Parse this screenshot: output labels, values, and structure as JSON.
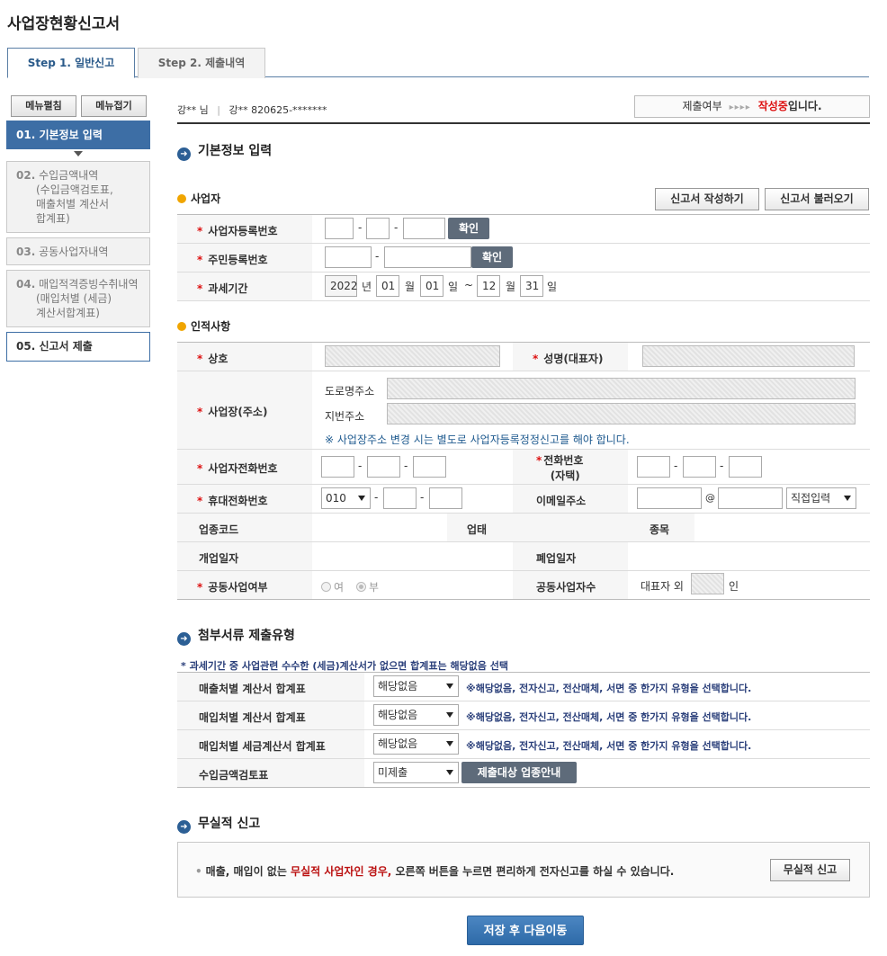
{
  "page": {
    "title": "사업장현황신고서"
  },
  "tabs": [
    {
      "label": "Step 1. 일반신고"
    },
    {
      "label": "Step 2. 제출내역"
    }
  ],
  "sidebar": {
    "menu_expand": "메뉴펼침",
    "menu_collapse": "메뉴접기",
    "items": [
      {
        "num": "01.",
        "label": "기본정보 입력"
      },
      {
        "num": "02.",
        "label": "수입금액내역",
        "sub1": "(수입금액검토표,",
        "sub2": "매출처별 계산서",
        "sub3": "합계표)"
      },
      {
        "num": "03.",
        "label": "공동사업자내역"
      },
      {
        "num": "04.",
        "label": "매입적격증빙수취내역",
        "sub1": "(매입처별 (세금)",
        "sub2": "계산서합계표)"
      },
      {
        "num": "05.",
        "label": "신고서 제출"
      }
    ]
  },
  "user": {
    "name": "강** 님",
    "sep": "|",
    "info": "강** 820625-*******"
  },
  "status": {
    "label": "제출여부",
    "arrows": "▸▸▸▸",
    "value": "작성중",
    "suffix": "입니다."
  },
  "basic": {
    "title": "기본정보 입력",
    "business_header": "사업자",
    "write_btn": "신고서 작성하기",
    "load_btn": "신고서 불러오기",
    "rows": {
      "bizno_label": "사업자등록번호",
      "resno_label": "주민등록번호",
      "period_label": "과세기간",
      "confirm": "확인",
      "dash": "-"
    },
    "period": {
      "year": "2022",
      "year_unit": "년",
      "m1": "01",
      "m_unit": "월",
      "d1": "01",
      "d_unit": "일",
      "tilde": "~",
      "m2": "12",
      "d2": "31"
    }
  },
  "personal": {
    "header": "인적사항",
    "trade_name": "상호",
    "rep_name": "성명(대표자)",
    "address": "사업장(주소)",
    "road": "도로명주소",
    "lot": "지번주소",
    "addr_note": "※ 사업장주소 변경 시는 별도로 사업자등록정정신고를 해야 합니다.",
    "biz_phone": "사업자전화번호",
    "home_phone_1": "전화번호",
    "home_phone_2": "(자택)",
    "mobile": "휴대전화번호",
    "mobile_prefix": "010",
    "email": "이메일주소",
    "at": "@",
    "email_select": "직접입력",
    "industry_code": "업종코드",
    "business_type": "업태",
    "item": "종목",
    "open_date": "개업일자",
    "close_date": "폐업일자",
    "joint": "공동사업여부",
    "yes": "여",
    "no": "부",
    "joint_count": "공동사업자수",
    "rep_extra": "대표자 외",
    "persons": "인"
  },
  "attach": {
    "title": "첨부서류 제출유형",
    "note": "* 과세기간 중 사업관련 수수한 (세금)계산서가 없으면 합계표는 해당없음 선택",
    "rows": [
      {
        "label": "매출처별 계산서 합계표",
        "value": "해당없음",
        "hint": "※해당없음, 전자신고, 전산매체, 서면 중 한가지 유형을 선택합니다."
      },
      {
        "label": "매입처별 계산서 합계표",
        "value": "해당없음",
        "hint": "※해당없음, 전자신고, 전산매체, 서면 중 한가지 유형을 선택합니다."
      },
      {
        "label": "매입처별 세금계산서 합계표",
        "value": "해당없음",
        "hint": "※해당없음, 전자신고, 전산매체, 서면 중 한가지 유형을 선택합니다."
      },
      {
        "label": "수입금액검토표",
        "value": "미제출",
        "btn": "제출대상 업종안내"
      }
    ]
  },
  "nil": {
    "title": "무실적 신고",
    "text_a": "매출, 매입이 없는 ",
    "text_red": "무실적 사업자인 경우,",
    "text_b": " 오른쪽 버튼을 누르면 편리하게 전자신고를 하실 수 있습니다.",
    "btn": "무실적 신고"
  },
  "save_btn": "저장 후 다음이동",
  "colors": {
    "primary": "#3d6ea5",
    "required": "#dd1111",
    "accent_orange": "#f0a500"
  }
}
